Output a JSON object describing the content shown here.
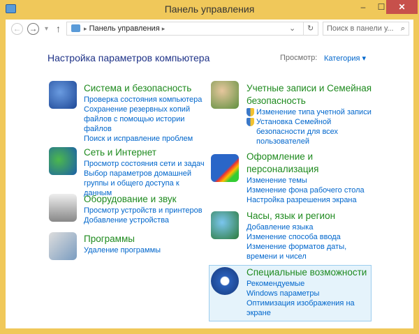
{
  "window": {
    "title": "Панель управления",
    "minimize": "–",
    "maximize": "☐",
    "close": "✕"
  },
  "toolbar": {
    "back": "←",
    "forward": "→",
    "recent": "▾",
    "up": "↑",
    "breadcrumb": "Панель управления",
    "sep": "▸",
    "dropdown": "⌄",
    "refresh": "↻",
    "search_placeholder": "Поиск в панели у...",
    "search_icon": "⌕"
  },
  "main": {
    "heading": "Настройка параметров компьютера",
    "view_label": "Просмотр:",
    "view_value": "Категория ▾"
  },
  "categories": [
    {
      "title": "Система и безопасность",
      "links": [
        "Проверка состояния компьютера",
        "Сохранение резервных копий файлов с помощью истории файлов",
        "Поиск и исправление проблем"
      ]
    },
    {
      "title": "Сеть и Интернет",
      "links": [
        "Просмотр состояния сети и задач",
        "Выбор параметров домашней группы и общего доступа к данным"
      ]
    },
    {
      "title": "Оборудование и звук",
      "links": [
        "Просмотр устройств и принтеров",
        "Добавление устройства"
      ]
    },
    {
      "title": "Программы",
      "links": [
        "Удаление программы"
      ]
    },
    {
      "title": "Учетные записи и Семейная безопасность",
      "links": [
        "Изменение типа учетной записи",
        "Установка Семейной безопасности для всех пользователей"
      ]
    },
    {
      "title": "Оформление и персонализация",
      "links": [
        "Изменение темы",
        "Изменение фона рабочего стола",
        "Настройка разрешения экрана"
      ]
    },
    {
      "title": "Часы, язык и регион",
      "links": [
        "Добавление языка",
        "Изменение способа ввода",
        "Изменение форматов даты, времени и чисел"
      ]
    },
    {
      "title": "Специальные возможности",
      "links": [
        "Рекомендуемые Windows параметры",
        "Оптимизация изображения на экране"
      ]
    }
  ]
}
